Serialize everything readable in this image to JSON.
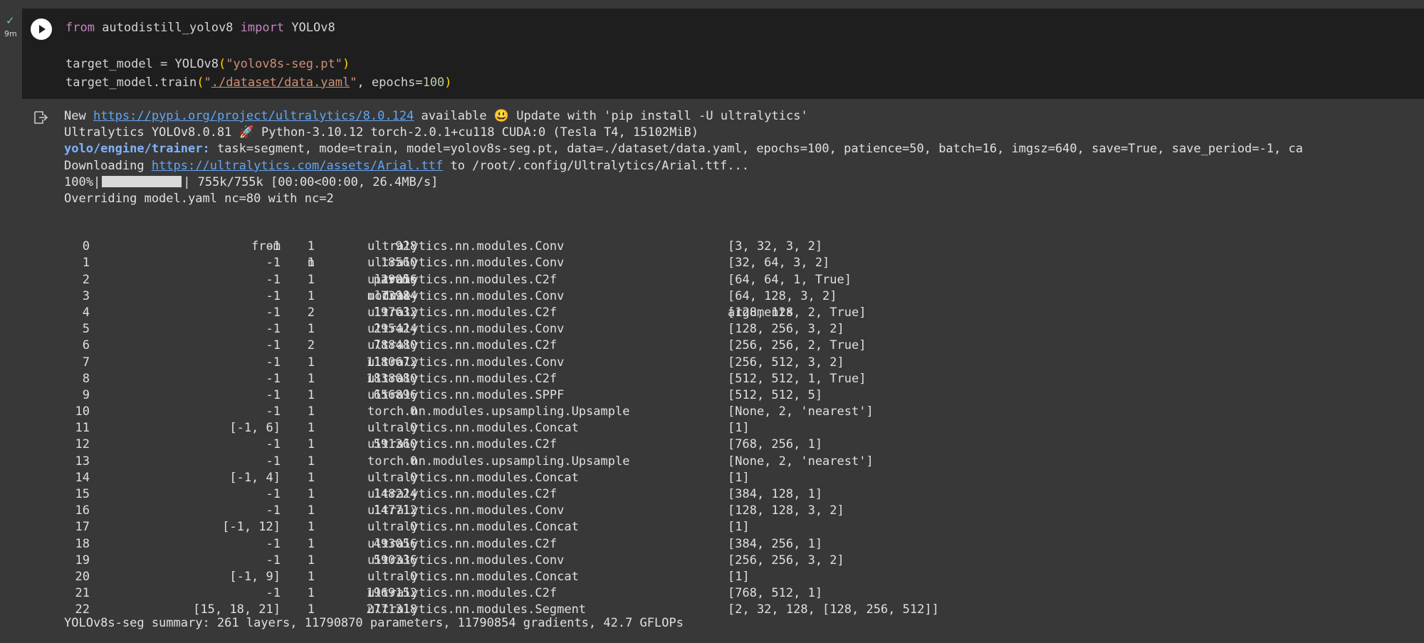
{
  "gutter": {
    "exec_status_icon": "check-icon",
    "exec_time": "9m"
  },
  "code": {
    "line1": {
      "kw_from": "from",
      "module": " autodistill_yolov8 ",
      "kw_import": "import",
      "name": " YOLOv8"
    },
    "line3": {
      "pre": "target_model = YOLOv8",
      "open": "(",
      "arg": "\"yolov8s-seg.pt\"",
      "close": ")"
    },
    "line4": {
      "pre": "target_model.train",
      "open": "(",
      "q1": "\"",
      "path": "./dataset/data.yaml",
      "q2": "\"",
      "mid": ", epochs=",
      "num": "100",
      "close": ")"
    }
  },
  "output": {
    "line1": {
      "pre": "New ",
      "link": "https://pypi.org/project/ultralytics/8.0.124",
      "post": " available 😃 Update with 'pip install -U ultralytics'"
    },
    "line2": "Ultralytics YOLOv8.0.81 🚀 Python-3.10.12 torch-2.0.1+cu118 CUDA:0 (Tesla T4, 15102MiB)",
    "line3": {
      "label": "yolo/engine/trainer:",
      "text": " task=segment, mode=train, model=yolov8s-seg.pt, data=./dataset/data.yaml, epochs=100, patience=50, batch=16, imgsz=640, save=True, save_period=-1, ca"
    },
    "line4": {
      "pre": "Downloading ",
      "link": "https://ultralytics.com/assets/Arial.ttf",
      "post": " to /root/.config/Ultralytics/Arial.ttf..."
    },
    "line5": {
      "pre": "100%|",
      "progress": 1.0,
      "post": "| 755k/755k [00:00<00:00, 26.4MB/s]"
    },
    "line6": "Overriding model.yaml nc=80 with nc=2"
  },
  "table": {
    "headers": {
      "from": "from",
      "n": "n",
      "params": "params",
      "module": "module",
      "arguments": "arguments"
    },
    "rows": [
      {
        "idx": "0",
        "from": "-1",
        "n": "1",
        "params": "928",
        "module": "ultralytics.nn.modules.Conv",
        "args": "[3, 32, 3, 2]"
      },
      {
        "idx": "1",
        "from": "-1",
        "n": "1",
        "params": "18560",
        "module": "ultralytics.nn.modules.Conv",
        "args": "[32, 64, 3, 2]"
      },
      {
        "idx": "2",
        "from": "-1",
        "n": "1",
        "params": "29056",
        "module": "ultralytics.nn.modules.C2f",
        "args": "[64, 64, 1, True]"
      },
      {
        "idx": "3",
        "from": "-1",
        "n": "1",
        "params": "73984",
        "module": "ultralytics.nn.modules.Conv",
        "args": "[64, 128, 3, 2]"
      },
      {
        "idx": "4",
        "from": "-1",
        "n": "2",
        "params": "197632",
        "module": "ultralytics.nn.modules.C2f",
        "args": "[128, 128, 2, True]"
      },
      {
        "idx": "5",
        "from": "-1",
        "n": "1",
        "params": "295424",
        "module": "ultralytics.nn.modules.Conv",
        "args": "[128, 256, 3, 2]"
      },
      {
        "idx": "6",
        "from": "-1",
        "n": "2",
        "params": "788480",
        "module": "ultralytics.nn.modules.C2f",
        "args": "[256, 256, 2, True]"
      },
      {
        "idx": "7",
        "from": "-1",
        "n": "1",
        "params": "1180672",
        "module": "ultralytics.nn.modules.Conv",
        "args": "[256, 512, 3, 2]"
      },
      {
        "idx": "8",
        "from": "-1",
        "n": "1",
        "params": "1838080",
        "module": "ultralytics.nn.modules.C2f",
        "args": "[512, 512, 1, True]"
      },
      {
        "idx": "9",
        "from": "-1",
        "n": "1",
        "params": "656896",
        "module": "ultralytics.nn.modules.SPPF",
        "args": "[512, 512, 5]"
      },
      {
        "idx": "10",
        "from": "-1",
        "n": "1",
        "params": "0",
        "module": "torch.nn.modules.upsampling.Upsample",
        "args": "[None, 2, 'nearest']"
      },
      {
        "idx": "11",
        "from": "[-1, 6]",
        "n": "1",
        "params": "0",
        "module": "ultralytics.nn.modules.Concat",
        "args": "[1]"
      },
      {
        "idx": "12",
        "from": "-1",
        "n": "1",
        "params": "591360",
        "module": "ultralytics.nn.modules.C2f",
        "args": "[768, 256, 1]"
      },
      {
        "idx": "13",
        "from": "-1",
        "n": "1",
        "params": "0",
        "module": "torch.nn.modules.upsampling.Upsample",
        "args": "[None, 2, 'nearest']"
      },
      {
        "idx": "14",
        "from": "[-1, 4]",
        "n": "1",
        "params": "0",
        "module": "ultralytics.nn.modules.Concat",
        "args": "[1]"
      },
      {
        "idx": "15",
        "from": "-1",
        "n": "1",
        "params": "148224",
        "module": "ultralytics.nn.modules.C2f",
        "args": "[384, 128, 1]"
      },
      {
        "idx": "16",
        "from": "-1",
        "n": "1",
        "params": "147712",
        "module": "ultralytics.nn.modules.Conv",
        "args": "[128, 128, 3, 2]"
      },
      {
        "idx": "17",
        "from": "[-1, 12]",
        "n": "1",
        "params": "0",
        "module": "ultralytics.nn.modules.Concat",
        "args": "[1]"
      },
      {
        "idx": "18",
        "from": "-1",
        "n": "1",
        "params": "493056",
        "module": "ultralytics.nn.modules.C2f",
        "args": "[384, 256, 1]"
      },
      {
        "idx": "19",
        "from": "-1",
        "n": "1",
        "params": "590336",
        "module": "ultralytics.nn.modules.Conv",
        "args": "[256, 256, 3, 2]"
      },
      {
        "idx": "20",
        "from": "[-1, 9]",
        "n": "1",
        "params": "0",
        "module": "ultralytics.nn.modules.Concat",
        "args": "[1]"
      },
      {
        "idx": "21",
        "from": "-1",
        "n": "1",
        "params": "1969152",
        "module": "ultralytics.nn.modules.C2f",
        "args": "[768, 512, 1]"
      },
      {
        "idx": "22",
        "from": "[15, 18, 21]",
        "n": "1",
        "params": "2771318",
        "module": "ultralytics.nn.modules.Segment",
        "args": "[2, 32, 128, [128, 256, 512]]"
      }
    ]
  },
  "summary": "YOLOv8s-seg summary: 261 layers, 11790870 parameters, 11790854 gradients, 42.7 GFLOPs",
  "colors": {
    "background": "#383838",
    "code_background": "#1e1e1e",
    "keyword": "#c586c0",
    "string": "#ce9178",
    "number": "#b5cea8",
    "link": "#61a6f5"
  }
}
